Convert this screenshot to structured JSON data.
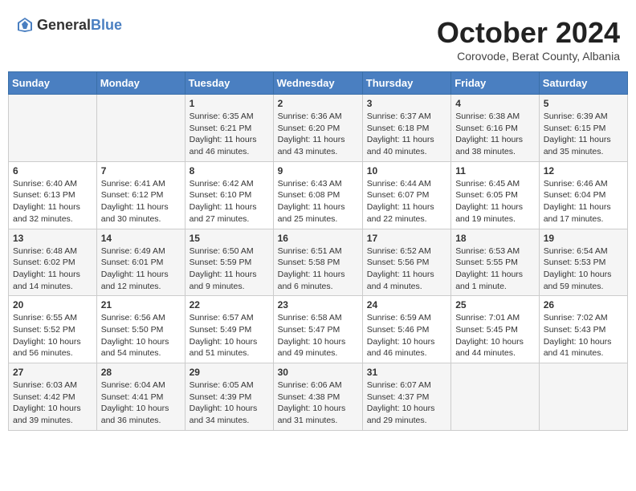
{
  "header": {
    "logo_general": "General",
    "logo_blue": "Blue",
    "month": "October 2024",
    "location": "Corovode, Berat County, Albania"
  },
  "days_of_week": [
    "Sunday",
    "Monday",
    "Tuesday",
    "Wednesday",
    "Thursday",
    "Friday",
    "Saturday"
  ],
  "weeks": [
    [
      {
        "day": "",
        "info": ""
      },
      {
        "day": "",
        "info": ""
      },
      {
        "day": "1",
        "info": "Sunrise: 6:35 AM\nSunset: 6:21 PM\nDaylight: 11 hours and 46 minutes."
      },
      {
        "day": "2",
        "info": "Sunrise: 6:36 AM\nSunset: 6:20 PM\nDaylight: 11 hours and 43 minutes."
      },
      {
        "day": "3",
        "info": "Sunrise: 6:37 AM\nSunset: 6:18 PM\nDaylight: 11 hours and 40 minutes."
      },
      {
        "day": "4",
        "info": "Sunrise: 6:38 AM\nSunset: 6:16 PM\nDaylight: 11 hours and 38 minutes."
      },
      {
        "day": "5",
        "info": "Sunrise: 6:39 AM\nSunset: 6:15 PM\nDaylight: 11 hours and 35 minutes."
      }
    ],
    [
      {
        "day": "6",
        "info": "Sunrise: 6:40 AM\nSunset: 6:13 PM\nDaylight: 11 hours and 32 minutes."
      },
      {
        "day": "7",
        "info": "Sunrise: 6:41 AM\nSunset: 6:12 PM\nDaylight: 11 hours and 30 minutes."
      },
      {
        "day": "8",
        "info": "Sunrise: 6:42 AM\nSunset: 6:10 PM\nDaylight: 11 hours and 27 minutes."
      },
      {
        "day": "9",
        "info": "Sunrise: 6:43 AM\nSunset: 6:08 PM\nDaylight: 11 hours and 25 minutes."
      },
      {
        "day": "10",
        "info": "Sunrise: 6:44 AM\nSunset: 6:07 PM\nDaylight: 11 hours and 22 minutes."
      },
      {
        "day": "11",
        "info": "Sunrise: 6:45 AM\nSunset: 6:05 PM\nDaylight: 11 hours and 19 minutes."
      },
      {
        "day": "12",
        "info": "Sunrise: 6:46 AM\nSunset: 6:04 PM\nDaylight: 11 hours and 17 minutes."
      }
    ],
    [
      {
        "day": "13",
        "info": "Sunrise: 6:48 AM\nSunset: 6:02 PM\nDaylight: 11 hours and 14 minutes."
      },
      {
        "day": "14",
        "info": "Sunrise: 6:49 AM\nSunset: 6:01 PM\nDaylight: 11 hours and 12 minutes."
      },
      {
        "day": "15",
        "info": "Sunrise: 6:50 AM\nSunset: 5:59 PM\nDaylight: 11 hours and 9 minutes."
      },
      {
        "day": "16",
        "info": "Sunrise: 6:51 AM\nSunset: 5:58 PM\nDaylight: 11 hours and 6 minutes."
      },
      {
        "day": "17",
        "info": "Sunrise: 6:52 AM\nSunset: 5:56 PM\nDaylight: 11 hours and 4 minutes."
      },
      {
        "day": "18",
        "info": "Sunrise: 6:53 AM\nSunset: 5:55 PM\nDaylight: 11 hours and 1 minute."
      },
      {
        "day": "19",
        "info": "Sunrise: 6:54 AM\nSunset: 5:53 PM\nDaylight: 10 hours and 59 minutes."
      }
    ],
    [
      {
        "day": "20",
        "info": "Sunrise: 6:55 AM\nSunset: 5:52 PM\nDaylight: 10 hours and 56 minutes."
      },
      {
        "day": "21",
        "info": "Sunrise: 6:56 AM\nSunset: 5:50 PM\nDaylight: 10 hours and 54 minutes."
      },
      {
        "day": "22",
        "info": "Sunrise: 6:57 AM\nSunset: 5:49 PM\nDaylight: 10 hours and 51 minutes."
      },
      {
        "day": "23",
        "info": "Sunrise: 6:58 AM\nSunset: 5:47 PM\nDaylight: 10 hours and 49 minutes."
      },
      {
        "day": "24",
        "info": "Sunrise: 6:59 AM\nSunset: 5:46 PM\nDaylight: 10 hours and 46 minutes."
      },
      {
        "day": "25",
        "info": "Sunrise: 7:01 AM\nSunset: 5:45 PM\nDaylight: 10 hours and 44 minutes."
      },
      {
        "day": "26",
        "info": "Sunrise: 7:02 AM\nSunset: 5:43 PM\nDaylight: 10 hours and 41 minutes."
      }
    ],
    [
      {
        "day": "27",
        "info": "Sunrise: 6:03 AM\nSunset: 4:42 PM\nDaylight: 10 hours and 39 minutes."
      },
      {
        "day": "28",
        "info": "Sunrise: 6:04 AM\nSunset: 4:41 PM\nDaylight: 10 hours and 36 minutes."
      },
      {
        "day": "29",
        "info": "Sunrise: 6:05 AM\nSunset: 4:39 PM\nDaylight: 10 hours and 34 minutes."
      },
      {
        "day": "30",
        "info": "Sunrise: 6:06 AM\nSunset: 4:38 PM\nDaylight: 10 hours and 31 minutes."
      },
      {
        "day": "31",
        "info": "Sunrise: 6:07 AM\nSunset: 4:37 PM\nDaylight: 10 hours and 29 minutes."
      },
      {
        "day": "",
        "info": ""
      },
      {
        "day": "",
        "info": ""
      }
    ]
  ]
}
